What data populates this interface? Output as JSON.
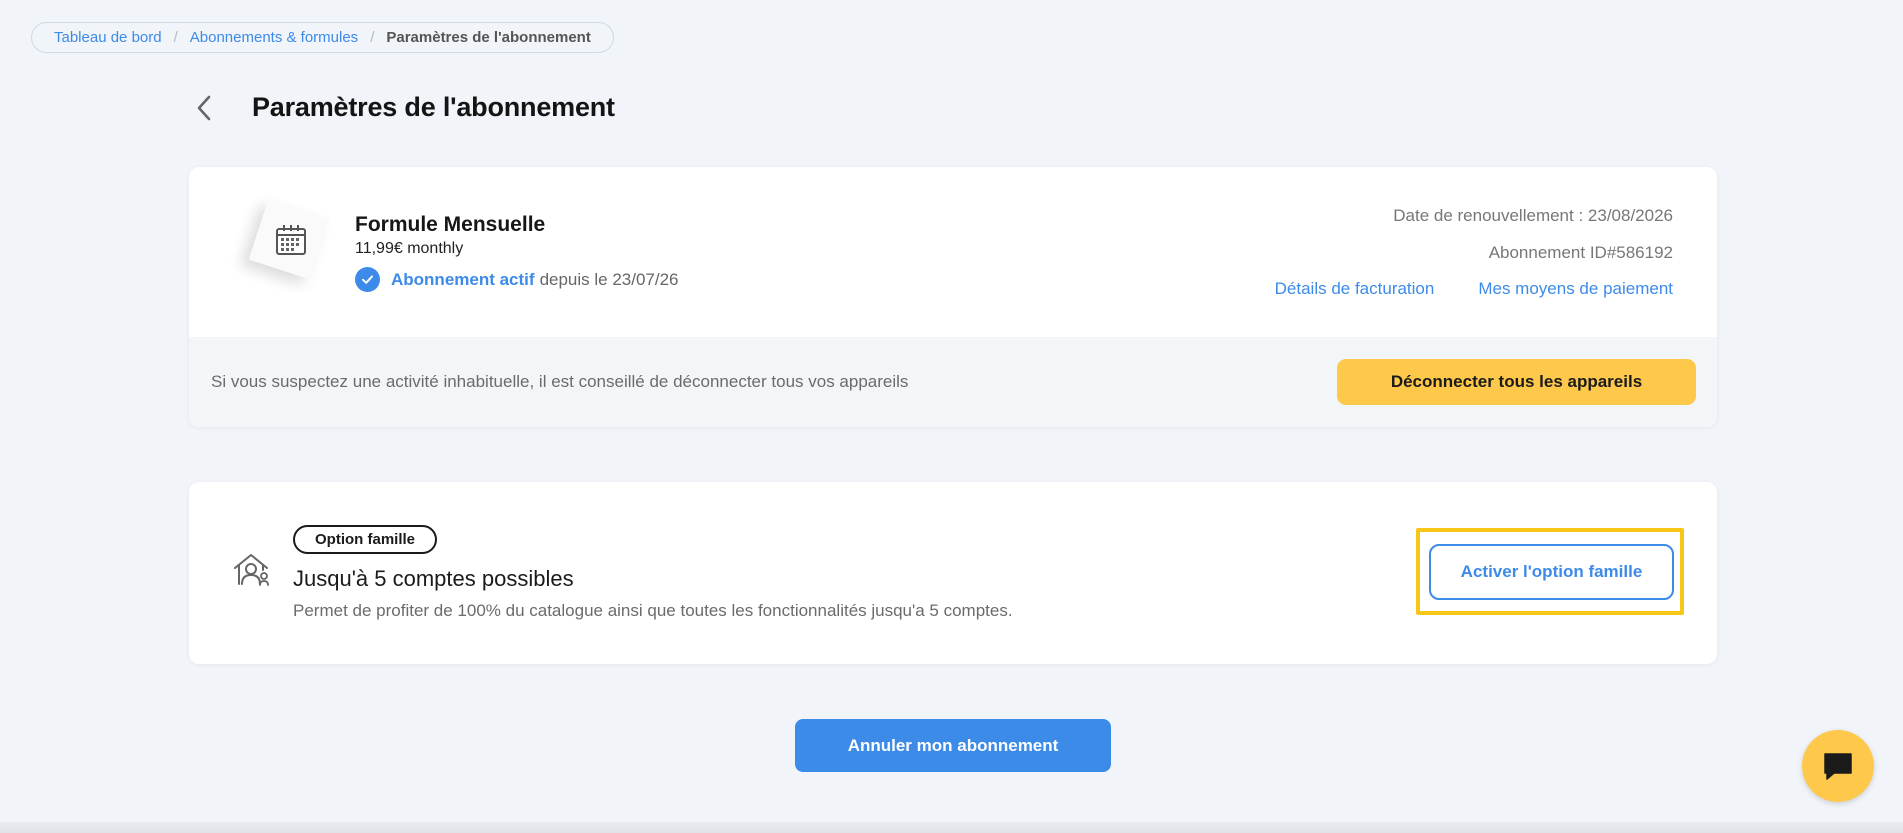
{
  "breadcrumb": {
    "items": [
      {
        "label": "Tableau de bord"
      },
      {
        "label": "Abonnements & formules"
      }
    ],
    "separator": "/",
    "current": "Paramètres de l'abonnement"
  },
  "header": {
    "back_icon": "chevron-left-icon",
    "title": "Paramètres de l'abonnement"
  },
  "subscription": {
    "icon": "calendar-icon",
    "plan_name": "Formule Mensuelle",
    "price": "11,99€ monthly",
    "status_icon": "check-circle-icon",
    "status_label": "Abonnement actif",
    "status_since": "depuis le 23/07/26",
    "renewal": "Date de renouvellement : 23/08/2026",
    "subscription_id": "Abonnement ID#586192",
    "billing_link": "Détails de facturation",
    "payment_link": "Mes moyens de paiement",
    "warning": "Si vous suspectez une activité inhabituelle, il est conseillé de déconnecter tous vos appareils",
    "disconnect_button": "Déconnecter tous les appareils"
  },
  "family": {
    "icon": "family-house-icon",
    "badge": "Option famille",
    "title": "Jusqu'à 5 comptes possibles",
    "description": "Permet de profiter de 100% du catalogue ainsi que toutes les fonctionnalités jusqu'a 5 comptes.",
    "activate_button": "Activer l'option famille"
  },
  "cancel_button": "Annuler mon abonnement",
  "chat": {
    "icon": "chat-bubble-icon"
  },
  "colors": {
    "accent": "#3d8be8",
    "yellow": "#fec84b",
    "highlight": "#f7c618",
    "background": "#f1f4f8"
  }
}
